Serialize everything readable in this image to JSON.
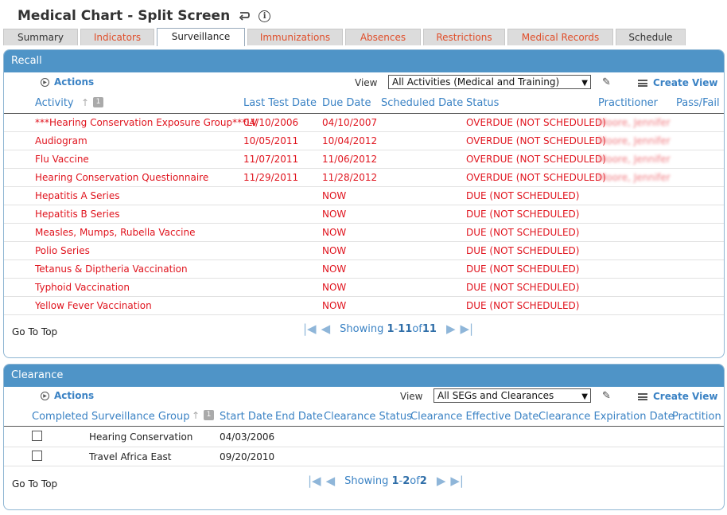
{
  "header": {
    "title": "Medical Chart - Split Screen",
    "back_icon": "back-arrow-icon",
    "info_icon": "info-icon"
  },
  "tabs": [
    {
      "label": "Summary"
    },
    {
      "label": "Indicators"
    },
    {
      "label": "Surveillance"
    },
    {
      "label": "Immunizations"
    },
    {
      "label": "Absences"
    },
    {
      "label": "Restrictions"
    },
    {
      "label": "Medical Records"
    },
    {
      "label": "Schedule"
    }
  ],
  "active_tab": "Surveillance",
  "recall": {
    "title": "Recall",
    "actions_label": "Actions",
    "view_label": "View",
    "view_value": "All Activities (Medical and Training)",
    "create_view_label": "Create View",
    "sort_badge": "1",
    "columns": [
      "Activity",
      "Last Test Date",
      "Due Date",
      "Scheduled Date",
      "Status",
      "Practitioner",
      "Pass/Fail"
    ],
    "rows": [
      {
        "activity": "***Hearing Conservation Exposure Group***LV",
        "last_test": "04/10/2006",
        "due": "04/10/2007",
        "scheduled": "",
        "status": "OVERDUE (NOT SCHEDULED)",
        "practitioner": "Moore, Jennifer",
        "pass_fail": ""
      },
      {
        "activity": "Audiogram",
        "last_test": "10/05/2011",
        "due": "10/04/2012",
        "scheduled": "",
        "status": "OVERDUE (NOT SCHEDULED)",
        "practitioner": "Moore, Jennifer",
        "pass_fail": ""
      },
      {
        "activity": "Flu Vaccine",
        "last_test": "11/07/2011",
        "due": "11/06/2012",
        "scheduled": "",
        "status": "OVERDUE (NOT SCHEDULED)",
        "practitioner": "Moore, Jennifer",
        "pass_fail": ""
      },
      {
        "activity": "Hearing Conservation Questionnaire",
        "last_test": "11/29/2011",
        "due": "11/28/2012",
        "scheduled": "",
        "status": "OVERDUE (NOT SCHEDULED)",
        "practitioner": "Moore, Jennifer",
        "pass_fail": ""
      },
      {
        "activity": "Hepatitis A Series",
        "last_test": "",
        "due": "NOW",
        "scheduled": "",
        "status": "DUE (NOT SCHEDULED)",
        "practitioner": "",
        "pass_fail": ""
      },
      {
        "activity": "Hepatitis B Series",
        "last_test": "",
        "due": "NOW",
        "scheduled": "",
        "status": "DUE (NOT SCHEDULED)",
        "practitioner": "",
        "pass_fail": ""
      },
      {
        "activity": "Measles, Mumps, Rubella Vaccine",
        "last_test": "",
        "due": "NOW",
        "scheduled": "",
        "status": "DUE (NOT SCHEDULED)",
        "practitioner": "",
        "pass_fail": ""
      },
      {
        "activity": "Polio Series",
        "last_test": "",
        "due": "NOW",
        "scheduled": "",
        "status": "DUE (NOT SCHEDULED)",
        "practitioner": "",
        "pass_fail": ""
      },
      {
        "activity": "Tetanus & Diptheria Vaccination",
        "last_test": "",
        "due": "NOW",
        "scheduled": "",
        "status": "DUE (NOT SCHEDULED)",
        "practitioner": "",
        "pass_fail": ""
      },
      {
        "activity": "Typhoid Vaccination",
        "last_test": "",
        "due": "NOW",
        "scheduled": "",
        "status": "DUE (NOT SCHEDULED)",
        "practitioner": "",
        "pass_fail": ""
      },
      {
        "activity": "Yellow Fever Vaccination",
        "last_test": "",
        "due": "NOW",
        "scheduled": "",
        "status": "DUE (NOT SCHEDULED)",
        "practitioner": "",
        "pass_fail": ""
      }
    ],
    "go_to_top": "Go To Top",
    "pager": {
      "showing": "Showing",
      "from": "1",
      "dash": " - ",
      "to": "11",
      "of": " of ",
      "total": "11"
    }
  },
  "clearance": {
    "title": "Clearance",
    "actions_label": "Actions",
    "view_label": "View",
    "view_value": "All SEGs and Clearances",
    "create_view_label": "Create View",
    "sort_badge": "1",
    "columns": [
      "Completed Surveillance Group",
      "Start Date",
      "End Date",
      "Clearance Status",
      "Clearance Effective Date",
      "Clearance Expiration Date",
      "Practitioner"
    ],
    "rows": [
      {
        "group": "Hearing Conservation",
        "start": "04/03/2006"
      },
      {
        "group": "Travel Africa East",
        "start": "09/20/2010"
      }
    ],
    "go_to_top": "Go To Top",
    "pager": {
      "showing": "Showing",
      "from": "1",
      "dash": " - ",
      "to": "2",
      "of": " of ",
      "total": "2"
    }
  },
  "colors": {
    "accent": "#4f94c7",
    "link": "#3a82c4",
    "alert": "#e0141e",
    "tab_text": "#e04e2a"
  }
}
